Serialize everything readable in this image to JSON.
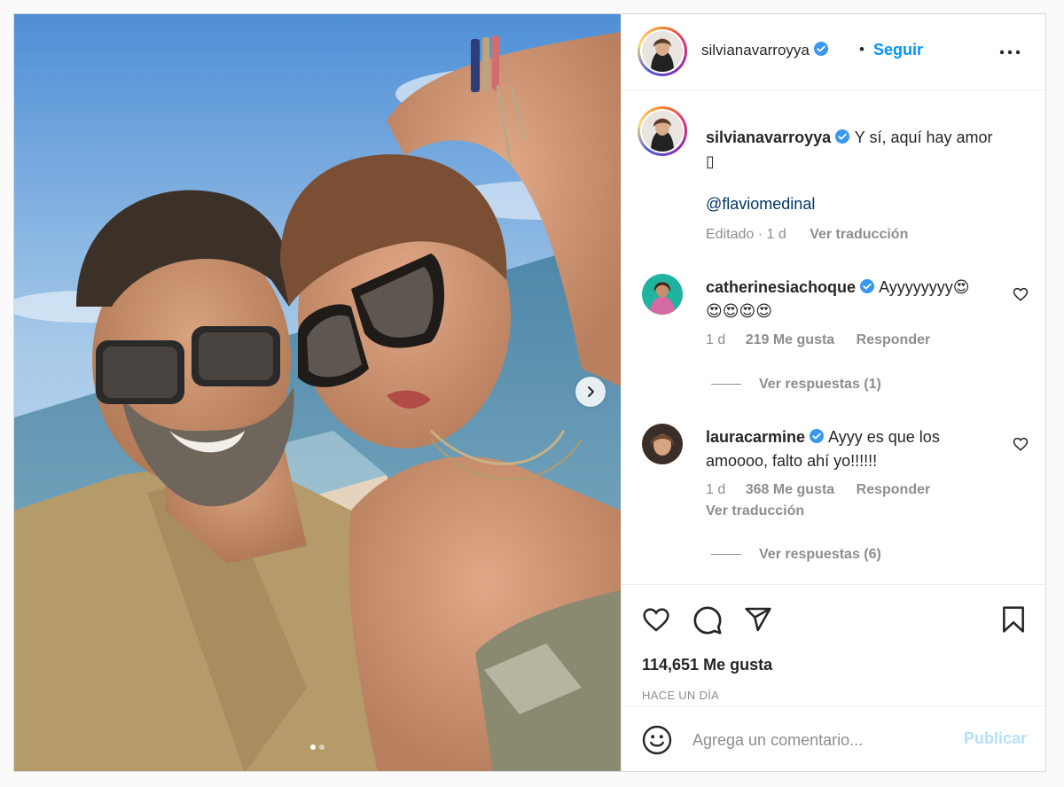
{
  "post": {
    "author": {
      "username": "silvianavarroyya",
      "verified": true,
      "follow_label": "Seguir",
      "separator": "•"
    },
    "photo": {
      "carousel_count": 2,
      "active_index": 0
    },
    "caption": {
      "username": "silvianavarroyya",
      "text": "Y sí, aquí hay amor",
      "emoji_placeholder": "▯",
      "mention": "@flaviomedinal",
      "edited_label": "Editado",
      "time": "1 d",
      "translate_label": "Ver traducción"
    },
    "comments": [
      {
        "username": "catherinesiachoque",
        "verified": true,
        "text_line1": "Ayyyyyyyy😍",
        "text_line2": "😍😍😍😍",
        "time": "1 d",
        "likes": "219 Me gusta",
        "reply_label": "Responder",
        "view_replies": "Ver respuestas (1)"
      },
      {
        "username": "lauracarmine",
        "verified": true,
        "text_line1": "Ayyy es que los",
        "text_line2": "amoooo, falto ahí yo!!!!!!",
        "time": "1 d",
        "likes": "368 Me gusta",
        "reply_label": "Responder",
        "translate_label": "Ver traducción",
        "view_replies": "Ver respuestas (6)"
      }
    ],
    "likes_count": "114,651 Me gusta",
    "timestamp": "Hace un día",
    "composer": {
      "placeholder": "Agrega un comentario...",
      "publish_label": "Publicar"
    }
  },
  "icons": {
    "heart": "heart-icon",
    "comment": "comment-icon",
    "share": "paper-plane-icon",
    "save": "bookmark-icon",
    "emoji": "smiley-icon",
    "more": "more-options-icon",
    "next": "chevron-right-icon",
    "verified": "verified-badge-icon"
  },
  "colors": {
    "accent": "#0095f6",
    "publish_disabled": "#b2dffc",
    "secondary_text": "#8e8e8e",
    "mention": "#00376b",
    "border": "#dbdbdb"
  }
}
